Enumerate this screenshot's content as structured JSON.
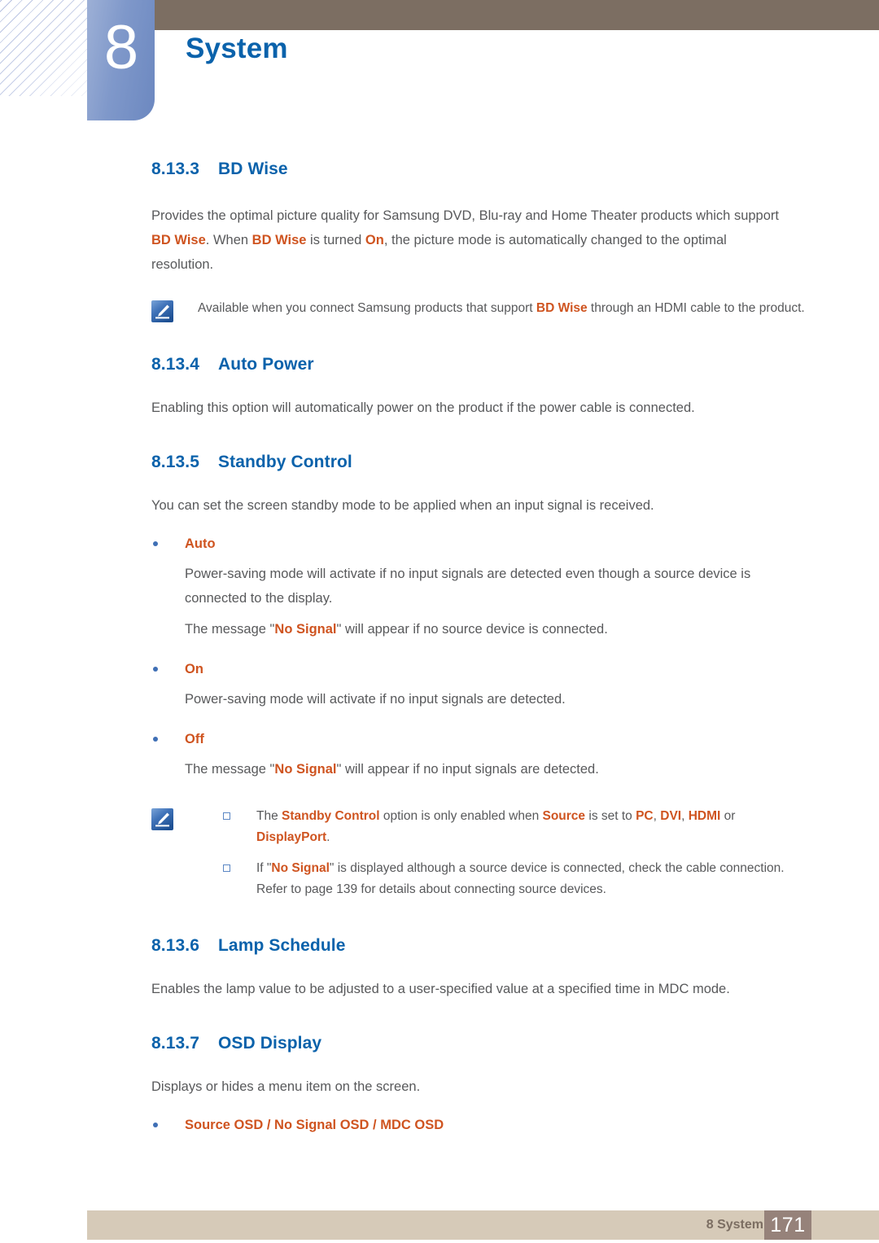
{
  "header": {
    "chapter_number": "8",
    "chapter_title": "System"
  },
  "colors": {
    "heading_blue": "#0a62ab",
    "accent_orange": "#cf5420",
    "body_gray": "#58595b",
    "topbar_brown": "#7c6e62",
    "footer_beige": "#d6cab8",
    "page_box_brown": "#96827a",
    "tab_blue": "#7f98ca"
  },
  "sections": {
    "bd_wise": {
      "number": "8.13.3",
      "title": "BD Wise",
      "paragraph": {
        "part1": "Provides the optimal picture quality for Samsung DVD, Blu-ray and Home Theater products which support ",
        "term1": "BD Wise",
        "part2": ". When ",
        "term2": "BD Wise",
        "part3": " is turned ",
        "term3": "On",
        "part4": ", the picture mode is automatically changed to the optimal resolution."
      },
      "note": {
        "part1": "Available when you connect Samsung products that support ",
        "term1": "BD Wise",
        "part2": " through an HDMI cable to the product."
      }
    },
    "auto_power": {
      "number": "8.13.4",
      "title": "Auto Power",
      "paragraph": "Enabling this option will automatically power on the product if the power cable is connected."
    },
    "standby_control": {
      "number": "8.13.5",
      "title": "Standby Control",
      "paragraph": "You can set the screen standby mode to be applied when an input signal is received.",
      "bullets": [
        {
          "label": "Auto",
          "lines": [
            {
              "text": "Power-saving mode will activate if no input signals are detected even though a source device is connected to the display."
            },
            {
              "part1": "The message \"",
              "term1": "No Signal",
              "part2": "\" will appear if no source device is connected."
            }
          ]
        },
        {
          "label": "On",
          "lines": [
            {
              "text": "Power-saving mode will activate if no input signals are detected."
            }
          ]
        },
        {
          "label": "Off",
          "lines": [
            {
              "part1": "The message \"",
              "term1": "No Signal",
              "part2": "\" will appear if no input signals are detected."
            }
          ]
        }
      ],
      "notes": [
        {
          "part1": "The ",
          "term1": "Standby Control",
          "part2": " option is only enabled when ",
          "term2": "Source",
          "part3": " is set to ",
          "term3": "PC",
          "part4": ", ",
          "term4": "DVI",
          "part5": ", ",
          "term5": "HDMI",
          "part6": " or ",
          "term6": "DisplayPort",
          "part7": "."
        },
        {
          "part1": "If \"",
          "term1": "No Signal",
          "part2": "\" is displayed although a source device is connected, check the cable connection. Refer to page 139 for details about connecting source devices."
        }
      ]
    },
    "lamp_schedule": {
      "number": "8.13.6",
      "title": "Lamp Schedule",
      "paragraph": "Enables the lamp value to be adjusted to a user-specified value at a specified time in MDC mode."
    },
    "osd_display": {
      "number": "8.13.7",
      "title": "OSD Display",
      "paragraph": "Displays or hides a menu item on the screen.",
      "bullet": "Source OSD / No Signal OSD / MDC OSD"
    }
  },
  "footer": {
    "label": "8 System",
    "page_number": "171"
  }
}
